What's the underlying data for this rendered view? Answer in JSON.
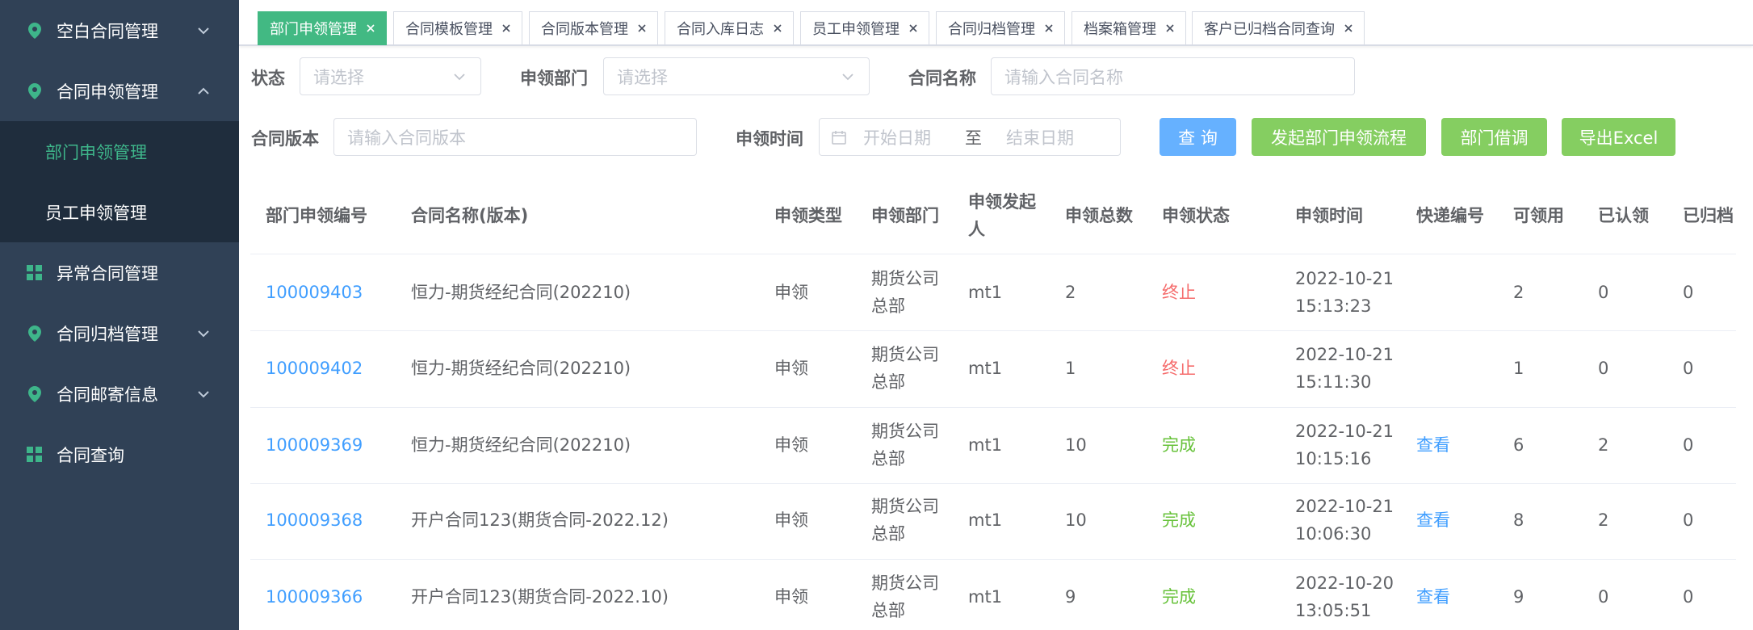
{
  "sidebar": {
    "items": [
      {
        "label": "空白合同管理",
        "icon": "location-pin-icon",
        "chevron": "down"
      },
      {
        "label": "合同申领管理",
        "icon": "location-pin-icon",
        "chevron": "up"
      },
      {
        "label": "部门申领管理",
        "sub": true,
        "active": true
      },
      {
        "label": "员工申领管理",
        "sub": true,
        "active": false
      },
      {
        "label": "异常合同管理",
        "icon": "grid-icon",
        "chevron": ""
      },
      {
        "label": "合同归档管理",
        "icon": "location-pin-icon",
        "chevron": "down"
      },
      {
        "label": "合同邮寄信息",
        "icon": "location-pin-icon",
        "chevron": "down"
      },
      {
        "label": "合同查询",
        "icon": "grid-icon",
        "chevron": ""
      }
    ]
  },
  "tabs": [
    {
      "label": "部门申领管理",
      "active": true
    },
    {
      "label": "合同模板管理",
      "active": false
    },
    {
      "label": "合同版本管理",
      "active": false
    },
    {
      "label": "合同入库日志",
      "active": false
    },
    {
      "label": "员工申领管理",
      "active": false
    },
    {
      "label": "合同归档管理",
      "active": false
    },
    {
      "label": "档案箱管理",
      "active": false
    },
    {
      "label": "客户已归档合同查询",
      "active": false
    }
  ],
  "filters": {
    "status_label": "状态",
    "status_placeholder": "请选择",
    "dept_label": "申领部门",
    "dept_placeholder": "请选择",
    "name_label": "合同名称",
    "name_placeholder": "请输入合同名称",
    "version_label": "合同版本",
    "version_placeholder": "请输入合同版本",
    "time_label": "申领时间",
    "start_placeholder": "开始日期",
    "range_sep": "至",
    "end_placeholder": "结束日期"
  },
  "buttons": {
    "query": "查 询",
    "start_flow": "发起部门申领流程",
    "borrow": "部门借调",
    "export": "导出Excel"
  },
  "colors": {
    "sidebar_bg": "#304156",
    "submenu_bg": "#1f2d3d",
    "accent_green": "#42b983",
    "primary_blue": "#409eff",
    "success_green": "#67c23a",
    "danger_red": "#f56c6c"
  },
  "table": {
    "headers": [
      "部门申领编号",
      "合同名称(版本)",
      "申领类型",
      "申领部门",
      "申领发起人",
      "申领总数",
      "申领状态",
      "申领时间",
      "快递编号",
      "可领用",
      "已认领",
      "已归档"
    ],
    "rows": [
      {
        "id": "100009403",
        "name": "恒力-期货经纪合同(202210)",
        "type": "申领",
        "dept": "期货公司总部",
        "initiator": "mt1",
        "total": "2",
        "status": "终止",
        "status_kind": "stop",
        "time_date": "2022-10-21",
        "time_clock": "15:13:23",
        "express": "",
        "available": "2",
        "claimed": "0",
        "archived": "0"
      },
      {
        "id": "100009402",
        "name": "恒力-期货经纪合同(202210)",
        "type": "申领",
        "dept": "期货公司总部",
        "initiator": "mt1",
        "total": "1",
        "status": "终止",
        "status_kind": "stop",
        "time_date": "2022-10-21",
        "time_clock": "15:11:30",
        "express": "",
        "available": "1",
        "claimed": "0",
        "archived": "0"
      },
      {
        "id": "100009369",
        "name": "恒力-期货经纪合同(202210)",
        "type": "申领",
        "dept": "期货公司总部",
        "initiator": "mt1",
        "total": "10",
        "status": "完成",
        "status_kind": "done",
        "time_date": "2022-10-21",
        "time_clock": "10:15:16",
        "express": "查看",
        "available": "6",
        "claimed": "2",
        "archived": "0"
      },
      {
        "id": "100009368",
        "name": "开户合同123(期货合同-2022.12)",
        "type": "申领",
        "dept": "期货公司总部",
        "initiator": "mt1",
        "total": "10",
        "status": "完成",
        "status_kind": "done",
        "time_date": "2022-10-21",
        "time_clock": "10:06:30",
        "express": "查看",
        "available": "8",
        "claimed": "2",
        "archived": "0"
      },
      {
        "id": "100009366",
        "name": "开户合同123(期货合同-2022.10)",
        "type": "申领",
        "dept": "期货公司总部",
        "initiator": "mt1",
        "total": "9",
        "status": "完成",
        "status_kind": "done",
        "time_date": "2022-10-20",
        "time_clock": "13:05:51",
        "express": "查看",
        "available": "9",
        "claimed": "0",
        "archived": "0"
      }
    ]
  }
}
